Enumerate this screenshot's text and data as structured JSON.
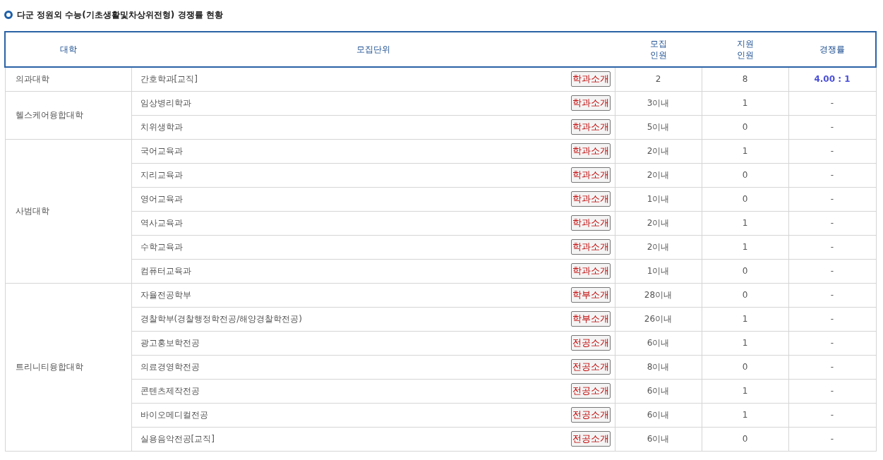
{
  "title": "다군 정원외 수능(기초생활및차상위전형) 경쟁률 현황",
  "table": {
    "columns": [
      "대학",
      "모집단위",
      "모집\n인원",
      "지원\n인원",
      "경쟁률"
    ],
    "groups": [
      {
        "college": "의과대학",
        "rows": [
          {
            "unit": "간호학과[교직]",
            "button": "학과소개",
            "quota": "2",
            "applicants": "8",
            "ratio": "4.00 : 1",
            "highlighted": true
          }
        ]
      },
      {
        "college": "헬스케어융합대학",
        "rows": [
          {
            "unit": "임상병리학과",
            "button": "학과소개",
            "quota": "3이내",
            "applicants": "1",
            "ratio": "-",
            "highlighted": false
          },
          {
            "unit": "치위생학과",
            "button": "학과소개",
            "quota": "5이내",
            "applicants": "0",
            "ratio": "-",
            "highlighted": false
          }
        ]
      },
      {
        "college": "사범대학",
        "rows": [
          {
            "unit": "국어교육과",
            "button": "학과소개",
            "quota": "2이내",
            "applicants": "1",
            "ratio": "-",
            "highlighted": false
          },
          {
            "unit": "지리교육과",
            "button": "학과소개",
            "quota": "2이내",
            "applicants": "0",
            "ratio": "-",
            "highlighted": false
          },
          {
            "unit": "영어교육과",
            "button": "학과소개",
            "quota": "1이내",
            "applicants": "0",
            "ratio": "-",
            "highlighted": false
          },
          {
            "unit": "역사교육과",
            "button": "학과소개",
            "quota": "2이내",
            "applicants": "1",
            "ratio": "-",
            "highlighted": false
          },
          {
            "unit": "수학교육과",
            "button": "학과소개",
            "quota": "2이내",
            "applicants": "1",
            "ratio": "-",
            "highlighted": false
          },
          {
            "unit": "컴퓨터교육과",
            "button": "학과소개",
            "quota": "1이내",
            "applicants": "0",
            "ratio": "-",
            "highlighted": false
          }
        ]
      },
      {
        "college": "트리니티융합대학",
        "rows": [
          {
            "unit": "자율전공학부",
            "button": "학부소개",
            "quota": "28이내",
            "applicants": "0",
            "ratio": "-",
            "highlighted": false
          },
          {
            "unit": "경찰학부(경찰행정학전공/해양경찰학전공)",
            "button": "학부소개",
            "quota": "26이내",
            "applicants": "1",
            "ratio": "-",
            "highlighted": false
          },
          {
            "unit": "광고홍보학전공",
            "button": "전공소개",
            "quota": "6이내",
            "applicants": "1",
            "ratio": "-",
            "highlighted": false
          },
          {
            "unit": "의료경영학전공",
            "button": "전공소개",
            "quota": "8이내",
            "applicants": "0",
            "ratio": "-",
            "highlighted": false
          },
          {
            "unit": "콘텐츠제작전공",
            "button": "전공소개",
            "quota": "6이내",
            "applicants": "1",
            "ratio": "-",
            "highlighted": false
          },
          {
            "unit": "바이오메디컬전공",
            "button": "전공소개",
            "quota": "6이내",
            "applicants": "1",
            "ratio": "-",
            "highlighted": false
          },
          {
            "unit": "실용음악전공[교직]",
            "button": "전공소개",
            "quota": "6이내",
            "applicants": "0",
            "ratio": "-",
            "highlighted": false
          }
        ]
      }
    ]
  }
}
